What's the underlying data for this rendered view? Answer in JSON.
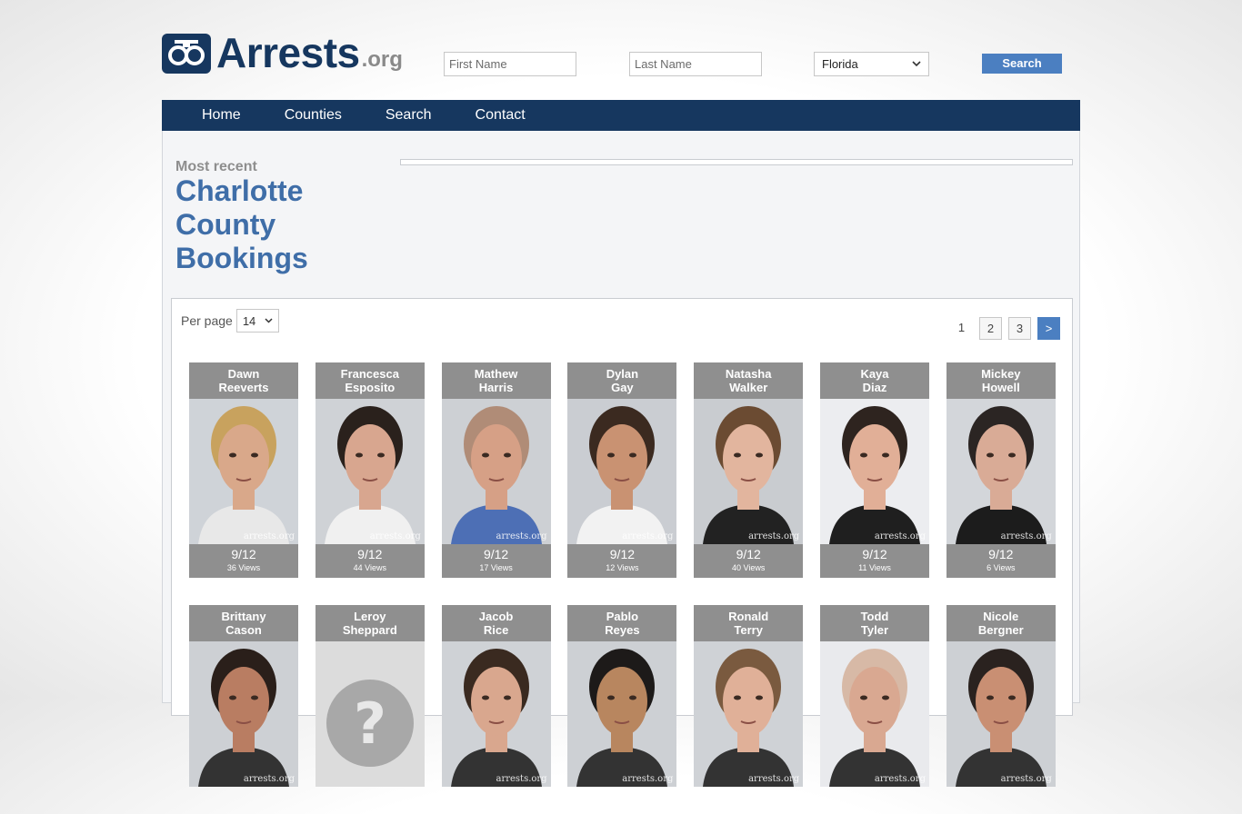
{
  "logo": {
    "name": "Arrests",
    "tld": ".org"
  },
  "search": {
    "first_placeholder": "First Name",
    "last_placeholder": "Last Name",
    "state": "Florida",
    "button": "Search"
  },
  "nav": [
    "Home",
    "Counties",
    "Search",
    "Contact"
  ],
  "section": {
    "sub": "Most recent",
    "title_lines": [
      "Charlotte",
      "County",
      "Bookings"
    ]
  },
  "listing": {
    "per_page_label": "Per page",
    "per_page": "14",
    "pages": [
      "1",
      "2",
      "3",
      ">"
    ],
    "watermark": "arrests.org"
  },
  "bookings": [
    {
      "first": "Dawn",
      "last": "Reeverts",
      "date": "9/12",
      "views": "36 Views",
      "hair": "#c8a25e",
      "skin": "#d9a88a",
      "bg": "#cfd3d8",
      "shirt": "#e8e8e8"
    },
    {
      "first": "Francesca",
      "last": "Esposito",
      "date": "9/12",
      "views": "44 Views",
      "hair": "#2a211c",
      "skin": "#d8a68f",
      "bg": "#cfd2d6",
      "shirt": "#f0f0f0"
    },
    {
      "first": "Mathew",
      "last": "Harris",
      "date": "9/12",
      "views": "17 Views",
      "hair": "#b08c77",
      "skin": "#d6a086",
      "bg": "#cdd0d4",
      "shirt": "#4d6fb5"
    },
    {
      "first": "Dylan",
      "last": "Gay",
      "date": "9/12",
      "views": "12 Views",
      "hair": "#3b2a20",
      "skin": "#c99272",
      "bg": "#cacdd2",
      "shirt": "#f2f2f2"
    },
    {
      "first": "Natasha",
      "last": "Walker",
      "date": "9/12",
      "views": "40 Views",
      "hair": "#6b4b32",
      "skin": "#e2b59e",
      "bg": "#c9ccd0",
      "shirt": "#222222"
    },
    {
      "first": "Kaya",
      "last": "Diaz",
      "date": "9/12",
      "views": "11 Views",
      "hair": "#2e241f",
      "skin": "#e1af97",
      "bg": "#ecedf0",
      "shirt": "#1f1f1f"
    },
    {
      "first": "Mickey",
      "last": "Howell",
      "date": "9/12",
      "views": "6 Views",
      "hair": "#2b2523",
      "skin": "#d9ab96",
      "bg": "#d3d6da",
      "shirt": "#1c1c1c"
    },
    {
      "first": "Brittany",
      "last": "Cason",
      "date": "",
      "views": "",
      "hair": "#2a1f1a",
      "skin": "#b97d62",
      "bg": "#cdd0d4",
      "shirt": "#333333"
    },
    {
      "first": "Leroy",
      "last": "Sheppard",
      "date": "",
      "views": "",
      "hair": "",
      "skin": "",
      "bg": "#dcdcdc",
      "shirt": "",
      "placeholder": true
    },
    {
      "first": "Jacob",
      "last": "Rice",
      "date": "",
      "views": "",
      "hair": "#3a2a20",
      "skin": "#d9a78e",
      "bg": "#cfd2d6",
      "shirt": "#333333"
    },
    {
      "first": "Pablo",
      "last": "Reyes",
      "date": "",
      "views": "",
      "hair": "#1d1a19",
      "skin": "#b8865f",
      "bg": "#cdd0d4",
      "shirt": "#333333"
    },
    {
      "first": "Ronald",
      "last": "Terry",
      "date": "",
      "views": "",
      "hair": "#7a5a3f",
      "skin": "#e0b098",
      "bg": "#cfd2d6",
      "shirt": "#333333"
    },
    {
      "first": "Todd",
      "last": "Tyler",
      "date": "",
      "views": "",
      "hair": "#d7b9a6",
      "skin": "#d9a891",
      "bg": "#e9eaed",
      "shirt": "#333333"
    },
    {
      "first": "Nicole",
      "last": "Bergner",
      "date": "",
      "views": "",
      "hair": "#2a221f",
      "skin": "#c98f73",
      "bg": "#cdd0d4",
      "shirt": "#333333"
    }
  ]
}
